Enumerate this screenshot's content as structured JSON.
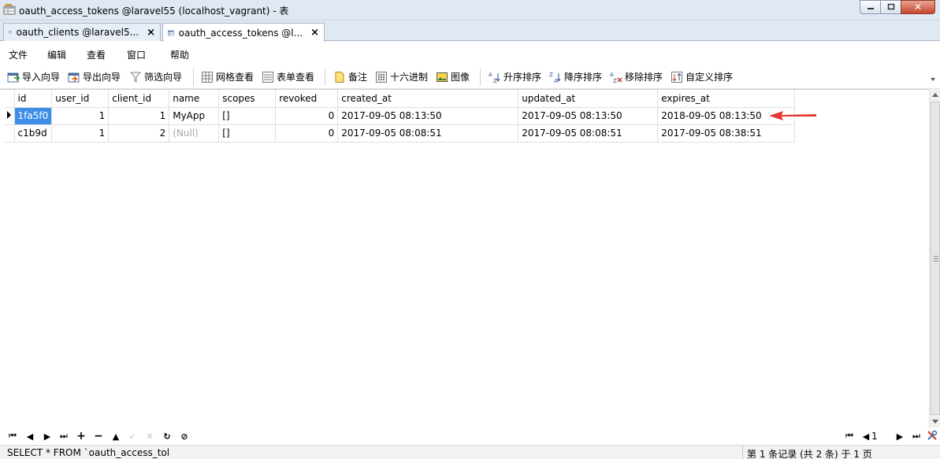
{
  "window": {
    "title": "oauth_access_tokens @laravel55 (localhost_vagrant) - 表",
    "close_symbol": "✕"
  },
  "tabs": [
    {
      "label": "oauth_clients @laravel5...",
      "close": "×"
    },
    {
      "label": "oauth_access_tokens @l...",
      "close": "×"
    }
  ],
  "menu": [
    "文件",
    "编辑",
    "查看",
    "窗口",
    "帮助"
  ],
  "toolbar": {
    "import_wizard": "导入向导",
    "export_wizard": "导出向导",
    "filter_wizard": "筛选向导",
    "grid_view": "网格查看",
    "form_view": "表单查看",
    "memo": "备注",
    "hex": "十六进制",
    "image": "图像",
    "sort_asc": "升序排序",
    "sort_desc": "降序排序",
    "remove_sort": "移除排序",
    "custom_sort": "自定义排序"
  },
  "grid": {
    "columns": [
      "id",
      "user_id",
      "client_id",
      "name",
      "scopes",
      "revoked",
      "created_at",
      "updated_at",
      "expires_at"
    ],
    "rows": [
      [
        "1fa5f0",
        "1",
        "1",
        "MyApp",
        "[]",
        "0",
        "2017-09-05 08:13:50",
        "2017-09-05 08:13:50",
        "2018-09-05 08:13:50"
      ],
      [
        "c1b9d",
        "1",
        "2",
        "(Null)",
        "[]",
        "0",
        "2017-09-05 08:08:51",
        "2017-09-05 08:08:51",
        "2017-09-05 08:38:51"
      ]
    ],
    "annotation_color": "#e53935"
  },
  "navigation": {
    "first": "⏮",
    "prev": "◀",
    "next": "▶",
    "last": "⏭",
    "add": "+",
    "delete": "−",
    "up": "▲",
    "check": "✓",
    "cancel": "✕",
    "refresh": "↻",
    "stop": "⊘",
    "page": "1"
  },
  "status": {
    "sql": "SELECT * FROM `oauth_access_tol",
    "records": "第 1 条记录 (共 2 条) 于 1 页"
  }
}
